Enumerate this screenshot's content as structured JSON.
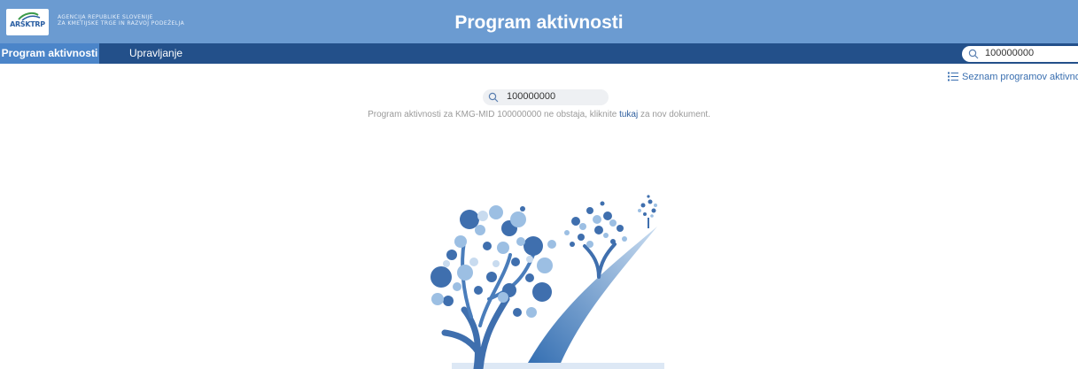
{
  "header": {
    "logo_text": "ARSKTRP",
    "agency_line1": "AGENCIJA REPUBLIKE SLOVENIJE",
    "agency_line2": "ZA KMETIJSKE TRGE IN RAZVOJ PODEŽELJA",
    "title": "Program aktivnosti"
  },
  "nav": {
    "tabs": [
      {
        "label": "Program aktivnosti",
        "active": true
      },
      {
        "label": "Upravljanje",
        "active": false
      }
    ],
    "search_value": "100000000"
  },
  "main": {
    "list_link": "Seznam programov aktivnos",
    "search_value": "100000000",
    "message_before": "Program aktivnosti za KMG-MID 100000000 ne obstaja, kliknite ",
    "message_link": "tukaj",
    "message_after": " za nov dokument."
  },
  "colors": {
    "header": "#6b9bd1",
    "nav": "#23508a",
    "active_tab": "#4b85c9",
    "link": "#2f5f9e"
  },
  "icons": [
    "search-icon",
    "list-icon",
    "logo-tractor-icon"
  ]
}
